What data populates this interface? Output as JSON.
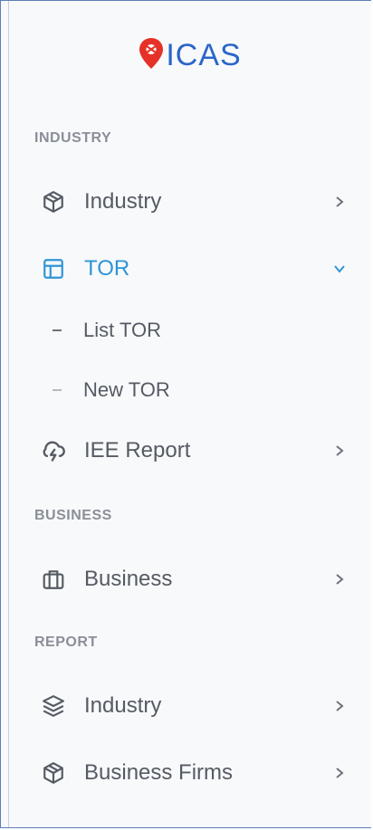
{
  "brand": {
    "name": "ICAS",
    "accent": "#2a66c8",
    "marker_color": "#e53127"
  },
  "sections": {
    "industry": "INDUSTRY",
    "business": "BUSINESS",
    "report": "REPORT"
  },
  "menu": {
    "industry": {
      "label": "Industry",
      "icon": "cube-icon"
    },
    "tor": {
      "label": "TOR",
      "icon": "layout-icon",
      "expanded": true,
      "children": [
        "List TOR",
        "New TOR"
      ]
    },
    "iee_report": {
      "label": "IEE Report",
      "icon": "cloud-lightning-icon"
    },
    "business": {
      "label": "Business",
      "icon": "briefcase-icon"
    },
    "report_industry": {
      "label": "Industry",
      "icon": "layers-icon"
    },
    "business_firms": {
      "label": "Business Firms",
      "icon": "cube-icon"
    }
  },
  "colors": {
    "active": "#2f95d6",
    "text": "#555b63",
    "section": "#8a8f98"
  }
}
